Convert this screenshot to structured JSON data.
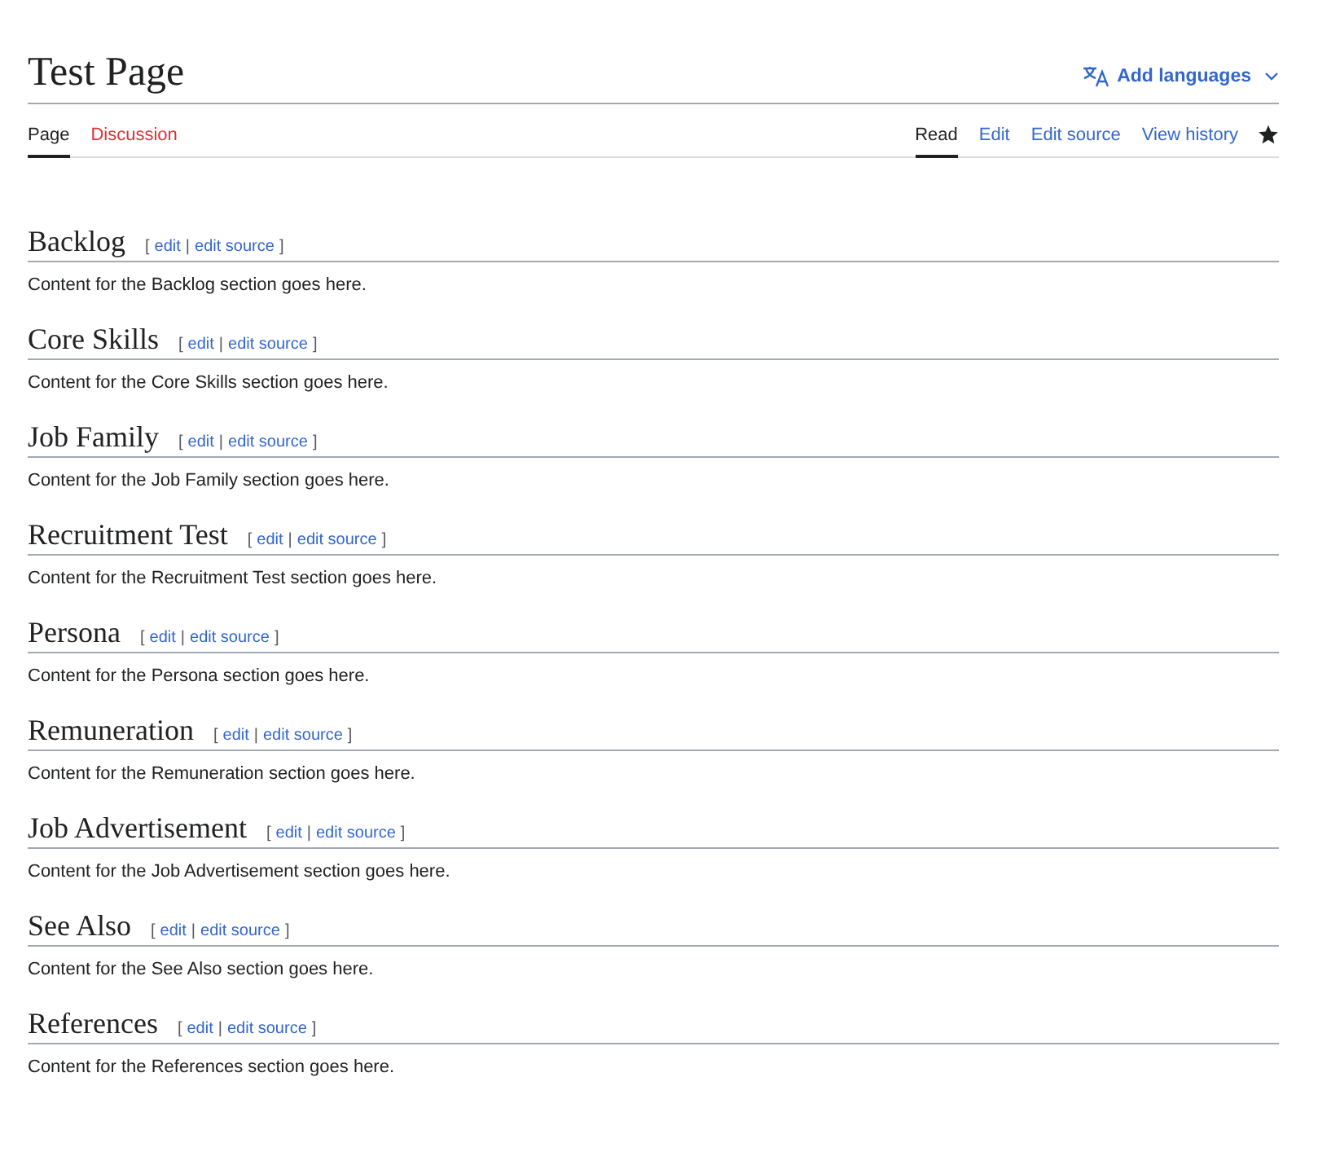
{
  "title": "Test Page",
  "languages": {
    "label": "Add languages"
  },
  "namespace_tabs": [
    {
      "label": "Page",
      "selected": true,
      "missing": false
    },
    {
      "label": "Discussion",
      "selected": false,
      "missing": true
    }
  ],
  "view_tabs": [
    {
      "label": "Read",
      "selected": true
    },
    {
      "label": "Edit",
      "selected": false
    },
    {
      "label": "Edit source",
      "selected": false
    },
    {
      "label": "View history",
      "selected": false
    }
  ],
  "sections": [
    {
      "heading": "Backlog",
      "open_bracket": "[",
      "edit": "edit",
      "separator": "|",
      "edit_source": "edit source",
      "close_bracket": "]",
      "content": "Content for the Backlog section goes here."
    },
    {
      "heading": "Core Skills",
      "open_bracket": "[",
      "edit": "edit",
      "separator": "|",
      "edit_source": "edit source",
      "close_bracket": "]",
      "content": "Content for the Core Skills section goes here."
    },
    {
      "heading": "Job Family",
      "open_bracket": "[",
      "edit": "edit",
      "separator": "|",
      "edit_source": "edit source",
      "close_bracket": "]",
      "content": "Content for the Job Family section goes here."
    },
    {
      "heading": "Recruitment Test",
      "open_bracket": "[",
      "edit": "edit",
      "separator": "|",
      "edit_source": "edit source",
      "close_bracket": "]",
      "content": "Content for the Recruitment Test section goes here."
    },
    {
      "heading": "Persona",
      "open_bracket": "[",
      "edit": "edit",
      "separator": "|",
      "edit_source": "edit source",
      "close_bracket": "]",
      "content": "Content for the Persona section goes here."
    },
    {
      "heading": "Remuneration",
      "open_bracket": "[",
      "edit": "edit",
      "separator": "|",
      "edit_source": "edit source",
      "close_bracket": "]",
      "content": "Content for the Remuneration section goes here."
    },
    {
      "heading": "Job Advertisement",
      "open_bracket": "[",
      "edit": "edit",
      "separator": "|",
      "edit_source": "edit source",
      "close_bracket": "]",
      "content": "Content for the Job Advertisement section goes here."
    },
    {
      "heading": "See Also",
      "open_bracket": "[",
      "edit": "edit",
      "separator": "|",
      "edit_source": "edit source",
      "close_bracket": "]",
      "content": "Content for the See Also section goes here."
    },
    {
      "heading": "References",
      "open_bracket": "[",
      "edit": "edit",
      "separator": "|",
      "edit_source": "edit source",
      "close_bracket": "]",
      "content": "Content for the References section goes here."
    }
  ]
}
